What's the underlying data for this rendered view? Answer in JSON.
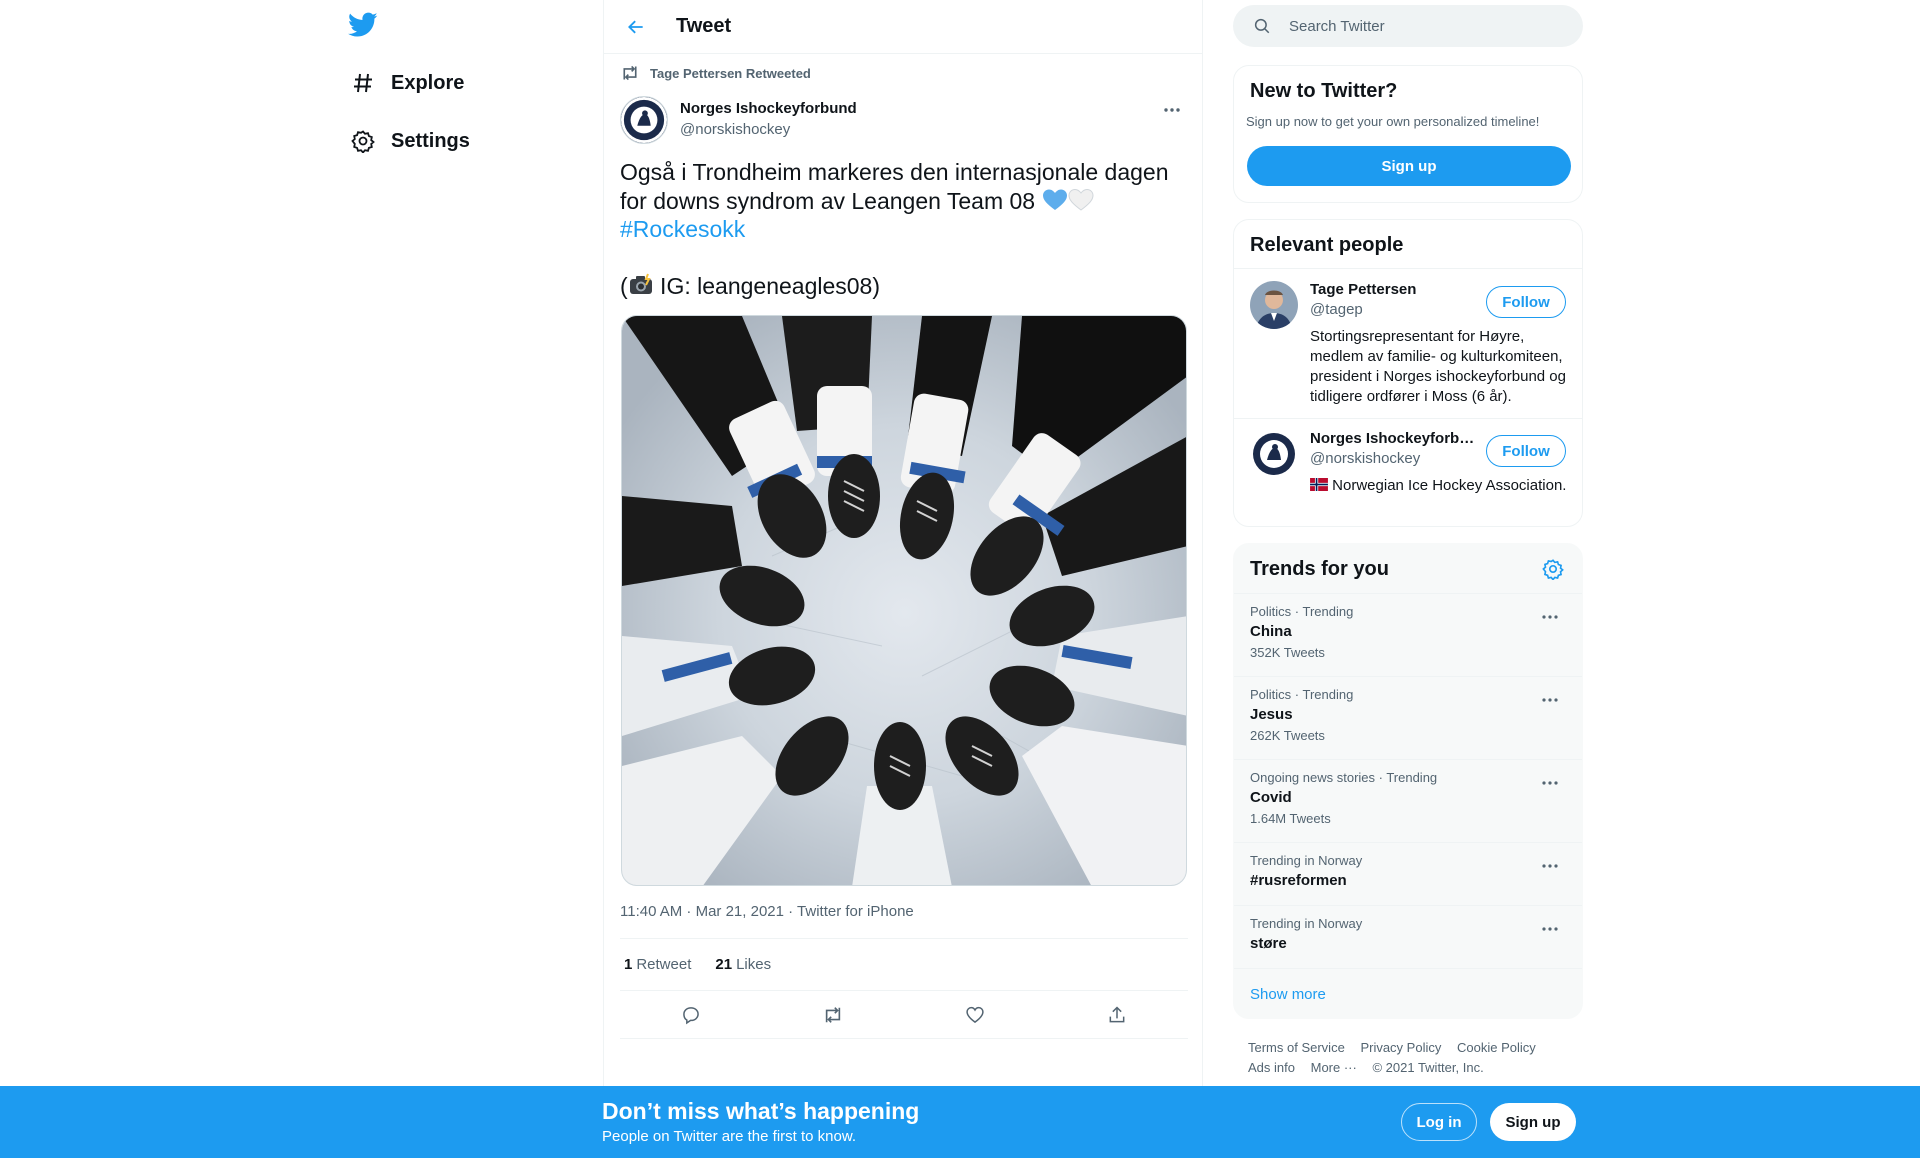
{
  "nav": {
    "items": [
      {
        "label": "Explore",
        "icon": "hashtag-icon"
      },
      {
        "label": "Settings",
        "icon": "gear-icon"
      }
    ]
  },
  "header": {
    "title": "Tweet"
  },
  "tweet": {
    "retweeted_by": "Tage Pettersen Retweeted",
    "author_name": "Norges Ishockeyforbund",
    "author_handle": "@norskishockey",
    "text_line1": "Også i Trondheim markeres den internasjonale dagen for downs syndrom av Leangen Team 08 ",
    "hashtag": "#Rockesokk",
    "text_line2_prefix": "(",
    "text_line2": " IG: leangeneagles08)",
    "timestamp": "11:40 AM · Mar 21, 2021 · Twitter for iPhone",
    "retweets_count": "1",
    "retweets_label": "Retweet",
    "likes_count": "21",
    "likes_label": "Likes"
  },
  "search": {
    "placeholder": "Search Twitter"
  },
  "new_to_twitter": {
    "title": "New to Twitter?",
    "subtitle": "Sign up now to get your own personalized timeline!",
    "button": "Sign up"
  },
  "relevant_people": {
    "title": "Relevant people",
    "people": [
      {
        "name": "Tage Pettersen",
        "handle": "@tagep",
        "bio": "Stortingsrepresentant for Høyre, medlem av familie- og kulturkomiteen, president i Norges ishockeyforbund og tidligere ordfører i Moss (6 år).",
        "follow": "Follow"
      },
      {
        "name": "Norges Ishockeyforbund",
        "handle": "@norskishockey",
        "bio": "Norwegian Ice Hockey Association.",
        "follow": "Follow"
      }
    ]
  },
  "trends": {
    "title": "Trends for you",
    "items": [
      {
        "context": "Politics · Trending",
        "name": "China",
        "count": "352K Tweets"
      },
      {
        "context": "Politics · Trending",
        "name": "Jesus",
        "count": "262K Tweets"
      },
      {
        "context": "Ongoing news stories · Trending",
        "name": "Covid",
        "count": "1.64M Tweets"
      },
      {
        "context": "Trending in Norway",
        "name": "#rusreformen",
        "count": ""
      },
      {
        "context": "Trending in Norway",
        "name": "støre",
        "count": ""
      }
    ],
    "show_more": "Show more"
  },
  "footer": {
    "links": [
      "Terms of Service",
      "Privacy Policy",
      "Cookie Policy",
      "Ads info",
      "More ···",
      "© 2021 Twitter, Inc."
    ]
  },
  "banner": {
    "title": "Don’t miss what’s happening",
    "subtitle": "People on Twitter are the first to know.",
    "login": "Log in",
    "signup": "Sign up"
  },
  "colors": {
    "accent": "#1d9bf0",
    "text": "#0f1419",
    "muted": "#536471"
  }
}
